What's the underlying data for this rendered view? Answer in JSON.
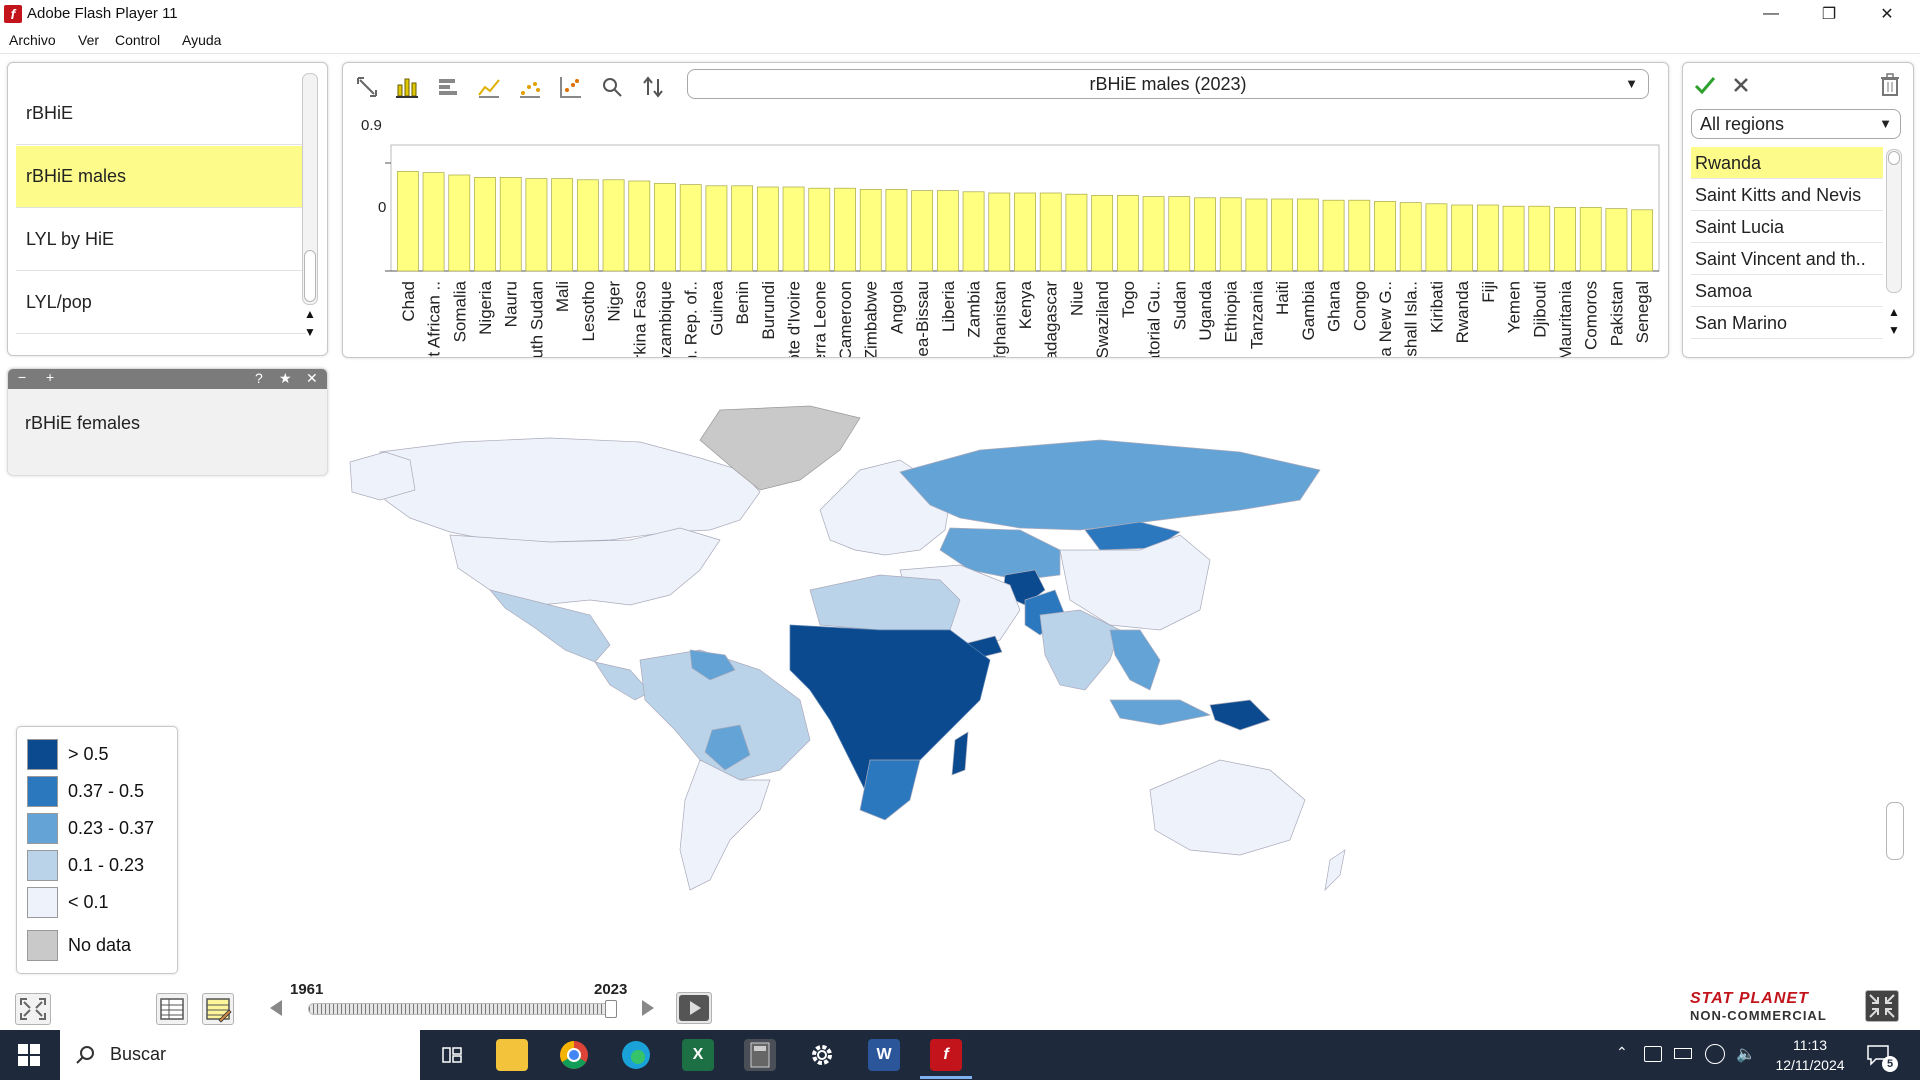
{
  "window": {
    "title": "Adobe Flash Player 11",
    "app_icon_glyph": "f"
  },
  "menu": [
    "Archivo",
    "Ver",
    "Control",
    "Ayuda"
  ],
  "indicators": {
    "items": [
      "rBHiE",
      "rBHiE males",
      "LYL by HiE",
      "LYL/pop"
    ],
    "selected": "rBHiE males"
  },
  "sub_panel": {
    "label": "rBHiE females",
    "controls": [
      "−",
      "+",
      "?",
      "★",
      "✕"
    ]
  },
  "chart_toolbar": {
    "tools": [
      "fit-icon",
      "bar-chart-icon",
      "horizontal-bar-icon",
      "line-chart-icon",
      "scatter-icon",
      "scatter-grid-icon",
      "search-icon",
      "sort-icon"
    ],
    "selected_indicator": "rBHiE males (2023)"
  },
  "chart_data": {
    "type": "bar",
    "title": "",
    "ylim": [
      0,
      0.9
    ],
    "yticks": [
      "0.9",
      "0"
    ],
    "bar_color": "#ffff80",
    "categories": [
      "Chad",
      "Cent African ..",
      "Somalia",
      "Nigeria",
      "Nauru",
      "South Sudan",
      "Mali",
      "Lesotho",
      "Niger",
      "Burkina Faso",
      "Mozambique",
      "Dem. Rep. of..",
      "Guinea",
      "Benin",
      "Burundi",
      "Côte d'Ivoire",
      "Sierra Leone",
      "Cameroon",
      "Zimbabwe",
      "Angola",
      "Guinea-Bissau",
      "Liberia",
      "Zambia",
      "Afghanistan",
      "Kenya",
      "Madagascar",
      "Niue",
      "Swaziland",
      "Togo",
      "Equatorial Gu..",
      "Sudan",
      "Uganda",
      "Ethiopia",
      "Tanzania",
      "Haiti",
      "Gambia",
      "Ghana",
      "Congo",
      "Papua New G..",
      "Marshall Isla..",
      "Kiribati",
      "Rwanda",
      "Fiji",
      "Yemen",
      "Djibouti",
      "Mauritania",
      "Comoros",
      "Pakistan",
      "Senegal"
    ],
    "values": [
      0.83,
      0.82,
      0.8,
      0.78,
      0.78,
      0.77,
      0.77,
      0.76,
      0.76,
      0.75,
      0.73,
      0.72,
      0.71,
      0.71,
      0.7,
      0.7,
      0.69,
      0.69,
      0.68,
      0.68,
      0.67,
      0.67,
      0.66,
      0.65,
      0.65,
      0.65,
      0.64,
      0.63,
      0.63,
      0.62,
      0.62,
      0.61,
      0.61,
      0.6,
      0.6,
      0.6,
      0.59,
      0.59,
      0.58,
      0.57,
      0.56,
      0.55,
      0.55,
      0.54,
      0.54,
      0.53,
      0.53,
      0.52,
      0.51
    ]
  },
  "regions": {
    "dropdown": "All regions",
    "items": [
      "Rwanda",
      "Saint Kitts and Nevis",
      "Saint Lucia",
      "Saint Vincent and th..",
      "Samoa",
      "San Marino"
    ],
    "selected": "Rwanda"
  },
  "legend": {
    "items": [
      {
        "label": "> 0.5",
        "color": "#0b4a8e"
      },
      {
        "label": "0.37 - 0.5",
        "color": "#2b78bf"
      },
      {
        "label": "0.23 - 0.37",
        "color": "#63a3d6"
      },
      {
        "label": "0.1 - 0.23",
        "color": "#bad3e8"
      },
      {
        "label": "< 0.1",
        "color": "#eef2fb"
      },
      {
        "label": "No data",
        "color": "#c9c9c9"
      }
    ]
  },
  "timeline": {
    "start": "1961",
    "end": "2023",
    "value": 2023
  },
  "brand": {
    "line1": "STAT PLANET",
    "line2": "NON-COMMERCIAL"
  },
  "taskbar": {
    "search_placeholder": "Buscar",
    "time": "11:13",
    "date": "12/11/2024",
    "notifications": "5",
    "apps": [
      "task-view-icon",
      "file-explorer-icon",
      "chrome-icon",
      "edge-icon",
      "excel-icon",
      "calculator-icon",
      "settings-icon",
      "word-icon",
      "flash-icon"
    ]
  }
}
